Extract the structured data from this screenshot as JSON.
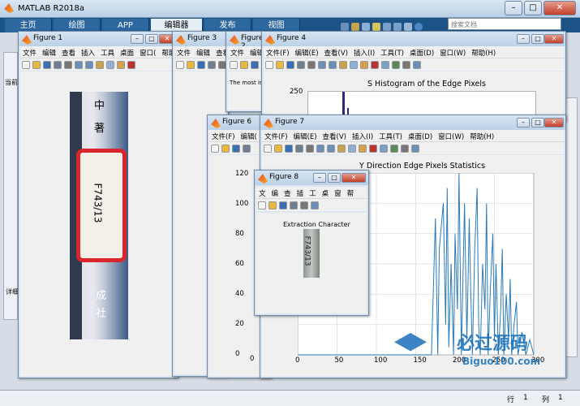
{
  "app": {
    "title": "MATLAB R2018a",
    "search_placeholder": "搜索文档",
    "tabs": [
      "主页",
      "绘图",
      "APP",
      "编辑器",
      "发布",
      "视图"
    ],
    "status_row": "行",
    "status_row_val": "1",
    "status_col": "列",
    "status_col_val": "1",
    "detail_label": "详细",
    "current_label": "当前"
  },
  "fig1": {
    "title": "Figure 1",
    "menu": [
      "文件",
      "编辑",
      "查看",
      "插入",
      "工具",
      "桌面",
      "窗口(",
      "帮助"
    ],
    "image_chars": [
      "中",
      "著",
      "F743/13",
      "成",
      "社"
    ]
  },
  "fig3": {
    "title": "Figure 3",
    "menu": [
      "文件",
      "编辑",
      "查看"
    ]
  },
  "fig2": {
    "title": "Figure 2",
    "menu": [
      "文件",
      "编辑"
    ],
    "text": "The most is"
  },
  "fig4": {
    "title": "Figure 4",
    "menu": [
      "文件(F)",
      "编辑(E)",
      "查看(V)",
      "插入(I)",
      "工具(T)",
      "桌面(D)",
      "窗口(W)",
      "帮助(H)"
    ],
    "plot_title": "S Histogram of the Edge Pixels",
    "ytick_top": "250"
  },
  "fig6": {
    "title": "Figure 6",
    "menu": [
      "文件(F)",
      "编辑("
    ],
    "yticks": [
      "120",
      "100",
      "80",
      "60",
      "40",
      "20",
      "0"
    ],
    "xtick": "0"
  },
  "fig7": {
    "title": "Figure 7",
    "menu": [
      "文件(F)",
      "编辑(E)",
      "查看(V)",
      "插入(I)",
      "工具(T)",
      "桌面(D)",
      "窗口(W)",
      "帮助(H)"
    ],
    "chart_data": {
      "type": "line",
      "title": "Y Direction Edge Pixels Statistics",
      "xticks": [
        "0",
        "50",
        "100",
        "150",
        "200",
        "250",
        "300"
      ],
      "yticks": [
        "",
        "",
        "",
        "",
        "",
        ""
      ],
      "xlim": [
        0,
        300
      ],
      "ylim": [
        0,
        120
      ],
      "x": [
        0,
        50,
        60,
        100,
        150,
        170,
        175,
        178,
        180,
        185,
        188,
        190,
        192,
        195,
        198,
        200,
        203,
        205,
        208,
        210,
        212,
        215,
        218,
        220,
        222,
        225,
        228,
        230,
        232,
        235,
        238,
        240,
        242,
        245,
        248,
        250,
        252,
        255,
        258,
        260,
        262,
        265,
        268,
        270,
        272,
        275,
        278,
        280,
        285,
        290,
        295,
        300
      ],
      "values": [
        0,
        0,
        0,
        0,
        0,
        0,
        90,
        0,
        70,
        100,
        20,
        110,
        5,
        60,
        0,
        80,
        30,
        120,
        0,
        50,
        100,
        10,
        90,
        40,
        0,
        70,
        110,
        20,
        0,
        60,
        30,
        100,
        0,
        45,
        80,
        10,
        60,
        0,
        30,
        70,
        0,
        40,
        10,
        50,
        0,
        20,
        35,
        0,
        15,
        0,
        10,
        0
      ]
    }
  },
  "fig8": {
    "title": "Figure 8",
    "menu": [
      "文",
      "编",
      "查",
      "插",
      "工",
      "桌",
      "窗",
      "帮"
    ],
    "plot_title": "Extraction Character",
    "image_text": "F743/13"
  },
  "watermark": {
    "cn": "必过源码",
    "en": "Biguo100.com"
  }
}
